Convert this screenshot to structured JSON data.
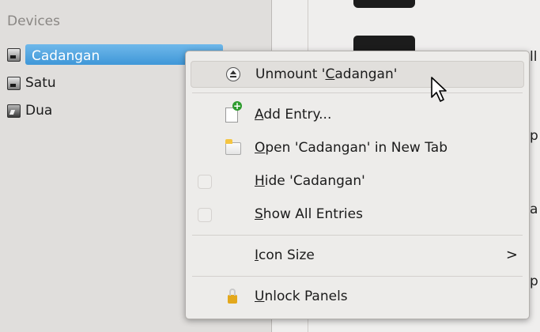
{
  "places": {
    "header": "Devices",
    "items": [
      {
        "label": "Cadangan",
        "selected": true,
        "icon": "drive-icon"
      },
      {
        "label": "Satu",
        "selected": false,
        "icon": "drive-icon"
      },
      {
        "label": "Dua",
        "selected": false,
        "icon": "drive-icon"
      }
    ]
  },
  "fileview": {
    "edge_texts": [
      "ll",
      "p",
      "a",
      "p"
    ]
  },
  "context_menu": {
    "unmount": {
      "prefix": "Unmount '",
      "mnemonic": "C",
      "suffix": "adangan'",
      "icon": "eject-icon"
    },
    "add_entry": {
      "mnemonic": "A",
      "suffix": "dd Entry...",
      "icon": "add-document-icon"
    },
    "open_new_tab": {
      "mnemonic": "O",
      "suffix": "pen 'Cadangan' in New Tab",
      "icon": "folder-icon"
    },
    "hide": {
      "mnemonic": "H",
      "suffix": "ide 'Cadangan'",
      "checked": false
    },
    "show_all": {
      "mnemonic": "S",
      "suffix": "how All Entries",
      "checked": false
    },
    "icon_size": {
      "mnemonic": "I",
      "suffix": "con Size",
      "submenu_arrow": ">"
    },
    "unlock_panels": {
      "mnemonic": "U",
      "suffix": "nlock Panels",
      "icon": "lock-icon"
    }
  },
  "colors": {
    "selection": "#3f97d8",
    "menu_bg": "#edecea",
    "panel_bg": "#e0dedc"
  }
}
